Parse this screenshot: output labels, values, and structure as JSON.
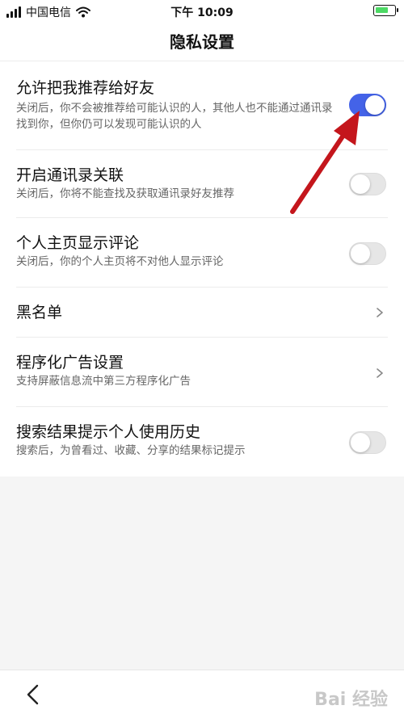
{
  "status_bar": {
    "carrier": "中国电信",
    "time": "下午 10:09"
  },
  "nav": {
    "title": "隐私设置"
  },
  "settings": [
    {
      "title": "允许把我推荐给好友",
      "subtitle": "关闭后，你不会被推荐给可能认识的人，其他人也不能通过通讯录找到你，但你仍可以发现可能认识的人",
      "control": "toggle",
      "on": true
    },
    {
      "title": "开启通讯录关联",
      "subtitle": "关闭后，你将不能查找及获取通讯录好友推荐",
      "control": "toggle",
      "on": false
    },
    {
      "title": "个人主页显示评论",
      "subtitle": "关闭后，你的个人主页将不对他人显示评论",
      "control": "toggle",
      "on": false
    },
    {
      "title": "黑名单",
      "subtitle": "",
      "control": "chevron"
    },
    {
      "title": "程序化广告设置",
      "subtitle": "支持屏蔽信息流中第三方程序化广告",
      "control": "chevron"
    },
    {
      "title": "搜索结果提示个人使用历史",
      "subtitle": "搜索后，为曾看过、收藏、分享的结果标记提示",
      "control": "toggle",
      "on": false
    }
  ],
  "watermark": "Bai 经验",
  "colors": {
    "toggle_on": "#4463e8",
    "annotation_arrow": "#c4161c"
  },
  "icons": {
    "back": "chevron-left-icon",
    "row_chevron": "chevron-right-icon"
  }
}
